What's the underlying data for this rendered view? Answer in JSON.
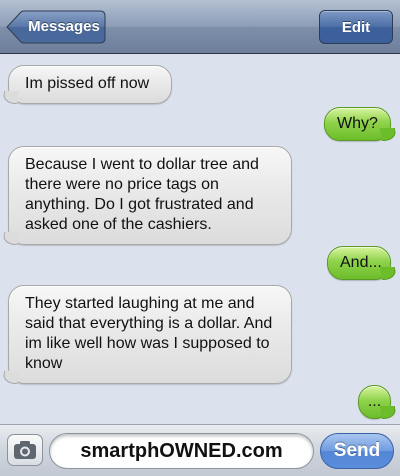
{
  "navbar": {
    "back_label": "Messages",
    "edit_label": "Edit"
  },
  "messages": [
    {
      "direction": "in",
      "text": "Im pissed off now"
    },
    {
      "direction": "out",
      "text": "Why?"
    },
    {
      "direction": "in",
      "text": "Because I went to dollar tree and there were no price tags on anything. Do I got frustrated and asked one of the cashiers."
    },
    {
      "direction": "out",
      "text": "And..."
    },
    {
      "direction": "in",
      "text": "They started laughing at me and said that everything is a dollar. And im like well how was I supposed to know"
    },
    {
      "direction": "out",
      "text": "..."
    }
  ],
  "toolbar": {
    "camera_icon": "camera-icon",
    "input_value": "smartphOWNED.com",
    "send_label": "Send"
  },
  "colors": {
    "background": "#dbe2ed",
    "incoming_bubble": "#e9e9e9",
    "outgoing_bubble": "#8fd24b",
    "send_button": "#5a8ddc"
  }
}
